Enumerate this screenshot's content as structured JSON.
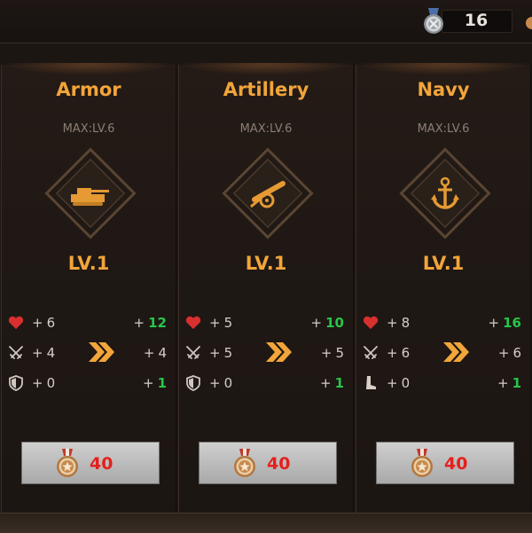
{
  "header": {
    "medal_count": "16",
    "medal_icon": "silver-medal-icon"
  },
  "colors": {
    "title": "#f2a53a",
    "increase": "#27c64a",
    "cost": "#e5201c",
    "heart": "#d82f2f"
  },
  "branches": [
    {
      "title": "Armor",
      "max": "MAX:LV.6",
      "emblem": "tank-icon",
      "level": "LV.1",
      "stats": [
        {
          "icon": "heart-icon",
          "current": "6",
          "next": "12"
        },
        {
          "icon": "crossed-swords-icon",
          "current": "4",
          "next": "4"
        },
        {
          "icon": "shield-icon",
          "current": "0",
          "next": "1"
        }
      ],
      "cost": "40",
      "cost_icon": "bronze-medal-icon"
    },
    {
      "title": "Artillery",
      "max": "MAX:LV.6",
      "emblem": "cannon-icon",
      "level": "LV.1",
      "stats": [
        {
          "icon": "heart-icon",
          "current": "5",
          "next": "10"
        },
        {
          "icon": "crossed-swords-icon",
          "current": "5",
          "next": "5"
        },
        {
          "icon": "shield-icon",
          "current": "0",
          "next": "1"
        }
      ],
      "cost": "40",
      "cost_icon": "bronze-medal-icon"
    },
    {
      "title": "Navy",
      "max": "MAX:LV.6",
      "emblem": "anchor-icon",
      "level": "LV.1",
      "stats": [
        {
          "icon": "heart-icon",
          "current": "8",
          "next": "16"
        },
        {
          "icon": "crossed-swords-icon",
          "current": "6",
          "next": "6"
        },
        {
          "icon": "boot-icon",
          "current": "0",
          "next": "1"
        }
      ],
      "cost": "40",
      "cost_icon": "bronze-medal-icon"
    }
  ]
}
